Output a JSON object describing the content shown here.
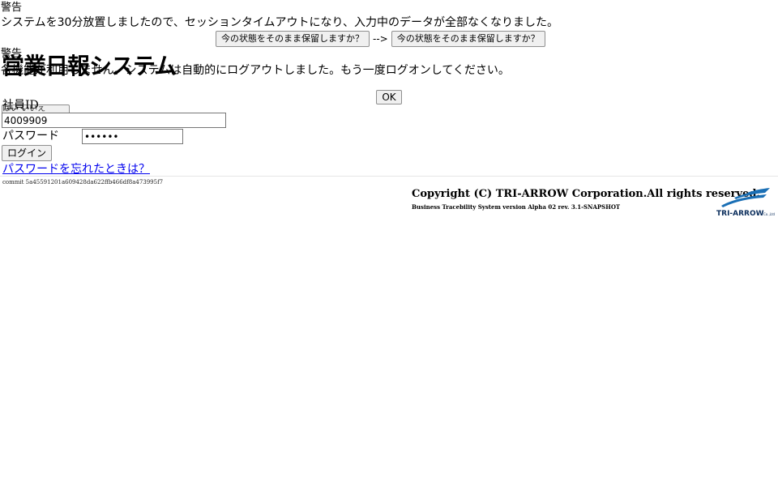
{
  "warning": {
    "title": "警告",
    "message": "システムを30分放置しましたので、セッションタイムアウトになり、入力中のデータが全部なくなりました。",
    "button_keep_left": "今の状態をそのまま保留しますか？",
    "arrow": "-->",
    "button_keep_right": "今の状態をそのまま保留しますか？"
  },
  "warning2": {
    "title": "警告",
    "message": "各機能が利用しません。システムは自動的にログアウトしました。もう一度ログオンしてください。",
    "ok_label": "OK"
  },
  "app": {
    "title": "営業日報システム"
  },
  "ghost": {
    "label": "はい いいえ"
  },
  "login": {
    "employee_id_label": "社員ID",
    "employee_id_value": "4009909",
    "password_label": "パスワード",
    "password_value": "••••••",
    "login_button": "ログイン",
    "forgot_link": "パスワードを忘れたときは？"
  },
  "footer": {
    "commit": "commit 5a45591201a609428da622ffb466df8a473995f7",
    "copyright": "Copyright (C) TRI-ARROW Corporation.All rights reserved.",
    "version": "Business Tracebility System version Alpha 02 rev. 3.1-SNAPSHOT",
    "logo_text": "TRI-ARROW",
    "logo_suffix": "Co.,Ltd",
    "logo_color": "#1a6fb5"
  }
}
